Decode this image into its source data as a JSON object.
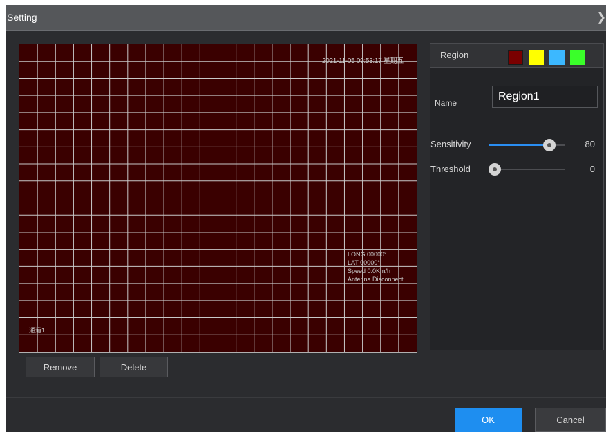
{
  "dialog": {
    "title": "Setting",
    "close_icon": "close-icon"
  },
  "video": {
    "timestamp": "2021-11-05 09:53:17 星期五",
    "info_lines": [
      "LONG 00000°",
      "LAT 00000°",
      "Speed 0.0Km/h",
      "Antenna Disconnect"
    ],
    "channel": "通道1",
    "grid": {
      "columns": 22,
      "rows": 18
    },
    "colors": {
      "background": "#3a0000",
      "grid_line": "#c8c8c8"
    }
  },
  "buttons": {
    "remove": "Remove",
    "delete": "Delete",
    "ok": "OK",
    "cancel": "Cancel"
  },
  "panel": {
    "region_label": "Region",
    "swatches": [
      {
        "name": "region1-color",
        "color": "#7a0000",
        "selected": true
      },
      {
        "name": "region2-color",
        "color": "#ffff00",
        "selected": false
      },
      {
        "name": "region3-color",
        "color": "#3cb8ff",
        "selected": false
      },
      {
        "name": "region4-color",
        "color": "#3aff2a",
        "selected": false
      }
    ],
    "name_label": "Name",
    "name_value": "Region1",
    "sensitivity": {
      "label": "Sensitivity",
      "value": "80",
      "fraction": 0.8
    },
    "threshold": {
      "label": "Threshold",
      "value": "0",
      "fraction": 0.0
    }
  },
  "colors": {
    "accent": "#1e8ef0",
    "slider_fill": "#2a8ef2"
  }
}
